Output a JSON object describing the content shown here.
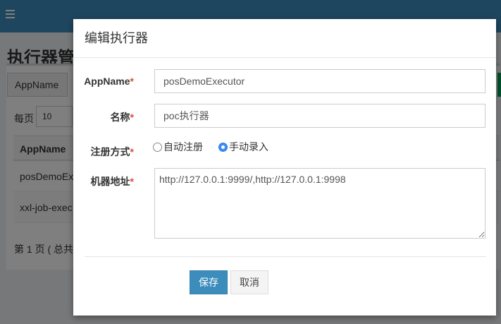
{
  "background": {
    "title": "执行器管",
    "search_addon": "AppName",
    "per_page_label": "每页",
    "per_page_value": "10",
    "table": {
      "header": "AppName",
      "rows": [
        "posDemoEx",
        "xxl-job-exec"
      ]
    },
    "pager": "第 1 页 ( 总共"
  },
  "modal": {
    "title": "编辑执行器",
    "fields": {
      "appname": {
        "label": "AppName",
        "value": "posDemoExecutor"
      },
      "name": {
        "label": "名称",
        "value": "poc执行器"
      },
      "register": {
        "label": "注册方式",
        "options": [
          "自动注册",
          "手动录入"
        ],
        "selected": "手动录入"
      },
      "address": {
        "label": "机器地址",
        "value": "http://127.0.0.1:9999/,http://127.0.0.1:9998"
      }
    },
    "required_mark": "*",
    "save_label": "保存",
    "cancel_label": "取消"
  },
  "colors": {
    "header_bar": "#3c8dbc",
    "primary_button": "#3c8dbc",
    "required": "#dd4b39",
    "radio_checked": "#3b8cf0"
  },
  "icons": {
    "menu": "hamburger-menu-icon"
  }
}
